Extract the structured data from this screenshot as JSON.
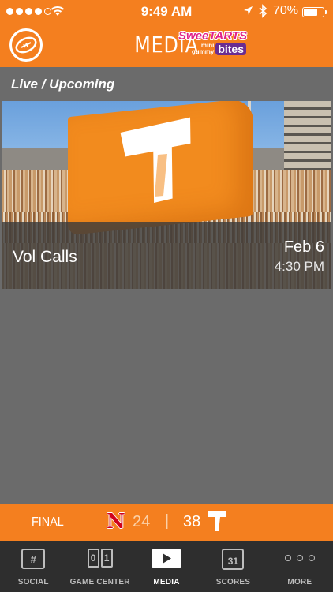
{
  "status_bar": {
    "time": "9:49 AM",
    "battery_percent": "70%",
    "battery_level": 0.7,
    "signal_bars": 4
  },
  "header": {
    "title": "MEDIA",
    "sponsor": {
      "line1": "SweeTARTS",
      "line2a": "mini gummy",
      "line2b": "bites"
    }
  },
  "section": {
    "title": "Live / Upcoming"
  },
  "media_items": [
    {
      "title": "Vol Calls",
      "date": "Feb 6",
      "time": "4:30 PM"
    }
  ],
  "scoreboard": {
    "status": "FINAL",
    "away_team_letter": "N",
    "away_score": "24",
    "separator": "|",
    "home_score": "38",
    "home_team_letter": "T"
  },
  "tabs": [
    {
      "label": "SOCIAL",
      "icon": "hashtag-bubble-icon",
      "icon_text": "#"
    },
    {
      "label": "GAME CENTER",
      "icon": "scoreboard-icon",
      "icon_text_1": "0",
      "icon_text_2": "1"
    },
    {
      "label": "MEDIA",
      "icon": "play-icon",
      "active": true
    },
    {
      "label": "SCORES",
      "icon": "calendar-icon",
      "icon_text": "31"
    },
    {
      "label": "MORE",
      "icon": "more-icon"
    }
  ],
  "colors": {
    "brand_orange": "#f47f1f",
    "background": "#6b6b6b",
    "tab_bar": "#2e2e2e",
    "nebraska_red": "#d0021b"
  }
}
